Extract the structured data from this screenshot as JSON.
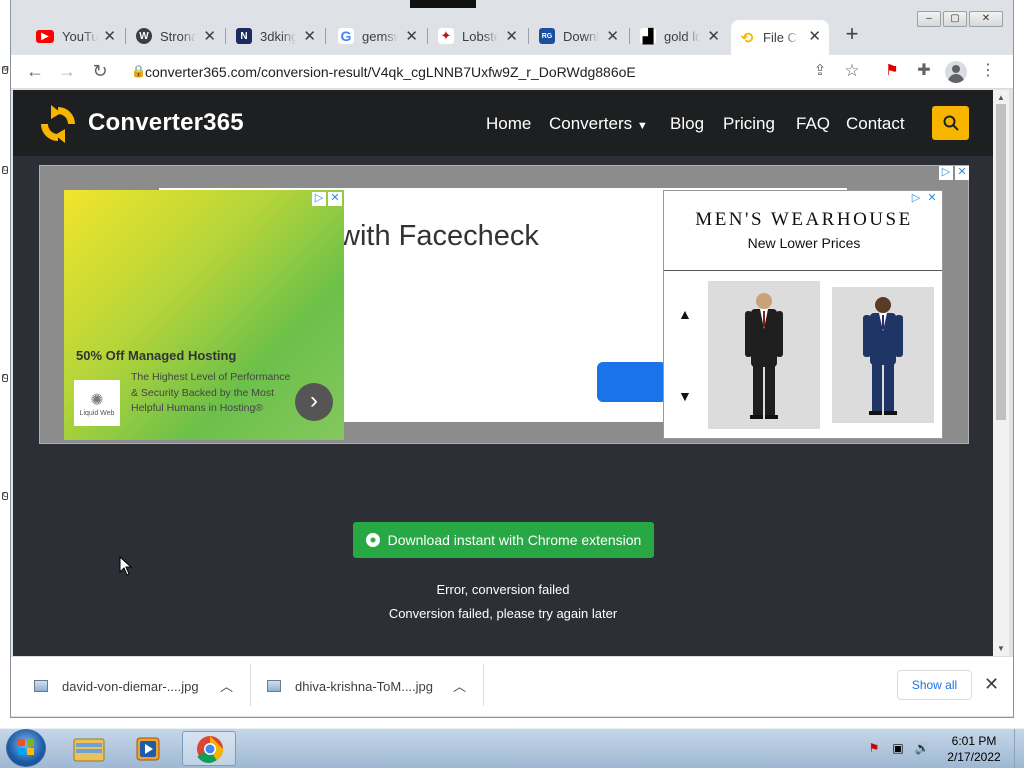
{
  "browser": {
    "tabs": [
      {
        "title": "YouTube",
        "icon": "youtube-icon",
        "color": "#ff0000"
      },
      {
        "title": "Strona",
        "icon": "wordpress-icon",
        "color": "#3c4043"
      },
      {
        "title": "3dking",
        "icon": "3dking-icon",
        "color": "#1b2a5c"
      },
      {
        "title": "gemsw",
        "icon": "google-icon",
        "color": "#4285f4"
      },
      {
        "title": "Lobster",
        "icon": "lobster-icon",
        "color": "#b31b1b"
      },
      {
        "title": "Downl",
        "icon": "download-site-icon",
        "color": "#1b4fa0"
      },
      {
        "title": "gold lo",
        "icon": "unsplash-icon",
        "color": "#000000"
      },
      {
        "title": "File Co",
        "icon": "converter-icon",
        "color": "#f7b500",
        "active": true
      }
    ],
    "url": "converter365.com/conversion-result/V4qk_cgLNNB7Uxfw9Z_r_DoRWdg886oE"
  },
  "site": {
    "logo_text": "Converter365",
    "nav": {
      "home": "Home",
      "converters": "Converters",
      "blog": "Blog",
      "pricing": "Pricing",
      "faq": "FAQ",
      "contact": "Contact"
    },
    "accent": "#f7b500"
  },
  "ads": {
    "facecheck_text": "with Facecheck",
    "hosting": {
      "title": "50% Off Managed Hosting",
      "logo_text": "Liquid Web",
      "description": "The Highest Level of Performance & Security Backed by the Most Helpful Humans in Hosting®"
    },
    "menswearhouse": {
      "brand": "MEN'S WEARHOUSE",
      "tagline": "New Lower Prices"
    }
  },
  "main": {
    "download_button": "Download instant with Chrome extension",
    "error_title": "Error, conversion failed",
    "error_message": "Conversion failed, please try again later",
    "button_color": "#28a745"
  },
  "downloads": {
    "items": [
      {
        "name": "david-von-diemar-....jpg"
      },
      {
        "name": "dhiva-krishna-ToM....jpg"
      }
    ],
    "show_all": "Show all"
  },
  "taskbar": {
    "time": "6:01 PM",
    "date": "2/17/2022"
  }
}
